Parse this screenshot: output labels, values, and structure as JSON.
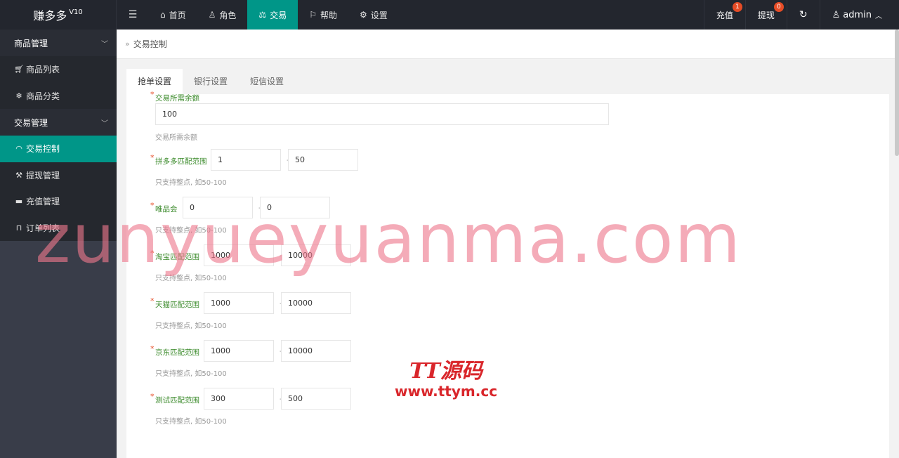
{
  "app": {
    "logo": "赚多多",
    "version": "V10"
  },
  "topnav": {
    "toggle_icon": "menu-icon",
    "items": [
      {
        "label": "首页",
        "icon": "home-icon"
      },
      {
        "label": "角色",
        "icon": "user-icon"
      },
      {
        "label": "交易",
        "icon": "scale-icon",
        "active": true
      },
      {
        "label": "帮助",
        "icon": "flag-icon"
      },
      {
        "label": "设置",
        "icon": "gear-icon"
      }
    ],
    "recharge": {
      "label": "充值",
      "badge": "1"
    },
    "withdraw": {
      "label": "提现",
      "badge": "0"
    },
    "refresh_icon": "refresh-icon",
    "user": {
      "label": "admin"
    }
  },
  "sidebar": {
    "groups": [
      {
        "label": "商品管理",
        "items": [
          {
            "label": "商品列表",
            "icon": "cart-icon"
          },
          {
            "label": "商品分类",
            "icon": "snowflake-icon"
          }
        ]
      },
      {
        "label": "交易管理",
        "items": [
          {
            "label": "交易控制",
            "icon": "gauge-icon",
            "active": true
          },
          {
            "label": "提现管理",
            "icon": "gavel-icon"
          },
          {
            "label": "充值管理",
            "icon": "monitor-icon"
          },
          {
            "label": "订单列表",
            "icon": "bag-icon"
          }
        ]
      }
    ]
  },
  "breadcrumb": {
    "current": "交易控制"
  },
  "tabs": [
    "抢单设置",
    "银行设置",
    "短信设置"
  ],
  "form": {
    "balance": {
      "label": "交易所需余额",
      "value": "100",
      "hint": "交易所需余额"
    },
    "ranges": [
      {
        "label": "拼多多匹配范围",
        "min": "1",
        "max": "50",
        "hint": "只支持整点, 如50-100"
      },
      {
        "label": "唯品会",
        "min": "0",
        "max": "0",
        "hint": "只支持整点, 如50-100"
      },
      {
        "label": "淘宝匹配范围",
        "min": "1000",
        "max": "10000",
        "hint": "只支持整点, 如50-100"
      },
      {
        "label": "天猫匹配范围",
        "min": "1000",
        "max": "10000",
        "hint": "只支持整点, 如50-100"
      },
      {
        "label": "京东匹配范围",
        "min": "1000",
        "max": "10000",
        "hint": "只支持整点, 如50-100"
      },
      {
        "label": "测试匹配范围",
        "min": "300",
        "max": "500",
        "hint": "只支持整点, 如50-100"
      }
    ]
  },
  "watermark": {
    "text": "zunyueyuanma.com",
    "stamp_title": "TT源码",
    "stamp_url": "www.ttym.cc"
  },
  "colors": {
    "accent": "#009688",
    "topbar": "#23262e",
    "sidebar": "#393d49",
    "badge": "#e64c26"
  }
}
